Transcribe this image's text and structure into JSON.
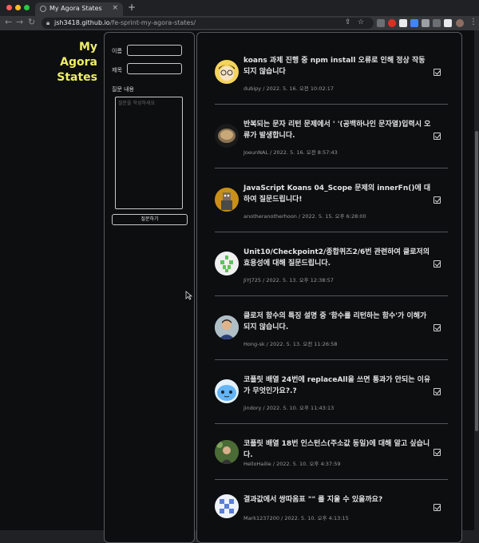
{
  "browser": {
    "tab_title": "My Agora States",
    "tab_close": "×",
    "new_tab": "+",
    "url_host": "jsh3418.github.io",
    "url_path": "/fe-sprint-my-agora-states/",
    "colors": {
      "close": "#ff5f57",
      "minimize": "#febc2e",
      "zoom": "#28c840"
    },
    "nav": {
      "back": "←",
      "forward": "→",
      "reload": "↻"
    },
    "omnibox_icons": {
      "share": "⇪",
      "bookmark": "☆"
    },
    "menu": "⋮"
  },
  "page": {
    "logo": {
      "line1": "My Agora",
      "line2": "States",
      "color": "#eeee66"
    },
    "form": {
      "name_label": "이름",
      "title_label": "제목",
      "content_label": "질문 내용",
      "content_placeholder": "질문을 작성하세요",
      "submit_label": "질문하기"
    },
    "questions": [
      {
        "title": "koans 과제 진행 중 npm install 오류로 인해 정상 작동 되지 않습니다",
        "author": "dubipy",
        "date": "2022. 5. 16. 오전 10:02:17",
        "avatar": "avatar-cartoon-boy-icon",
        "answered": true
      },
      {
        "title": "반복되는 문자 리턴 문제에서 ' '(공백하나인 문자열)입력시 오류가 발생합니다.",
        "author": "JoeunNAL",
        "date": "2022. 5. 16. 오전 8:57:43",
        "avatar": "avatar-food-bowl-icon",
        "answered": true
      },
      {
        "title": "JavaScript Koans 04_Scope 문제의 innerFn()에 대하여 질문드립니다!",
        "author": "anotheranotherhoon",
        "date": "2022. 5. 15. 오후 6:28:00",
        "avatar": "avatar-figure-icon",
        "answered": true
      },
      {
        "title": "Unit10/Checkpoint2/종합퀴즈2/6번 관련하여 클로저의 효용성에 대해 질문드립니다.",
        "author": "JiYJ725",
        "date": "2022. 5. 13. 오후 12:38:57",
        "avatar": "avatar-green-identicon-icon",
        "answered": true
      },
      {
        "title": "클로저 함수의 특징 설명 중 '함수를 리턴하는 함수'가 이해가 되지 않습니다.",
        "author": "Hong-sk",
        "date": "2022. 5. 13. 오전 11:26:58",
        "avatar": "avatar-person-photo-icon",
        "answered": true
      },
      {
        "title": "코플릿 배열 24번에 replaceAll을 쓰면 통과가 안되는 이유가 무엇인가요?.?",
        "author": "jindory",
        "date": "2022. 5. 10. 오후 11:43:13",
        "avatar": "avatar-cute-character-icon",
        "answered": true
      },
      {
        "title": "코플릿 배열 18번 인스턴스(주소값 동일)에 대해 알고 싶습니다.",
        "author": "HelloHailie",
        "date": "2022. 5. 10. 오후 4:37:59",
        "avatar": "avatar-nature-photo-icon",
        "answered": true
      },
      {
        "title": "결과값에서 쌍따옴표 \"\" 를 지울 수 있을까요?",
        "author": "Mark1237200",
        "date": "2022. 5. 10. 오후 4:13:15",
        "avatar": "avatar-blue-identicon-icon",
        "answered": true
      }
    ]
  }
}
